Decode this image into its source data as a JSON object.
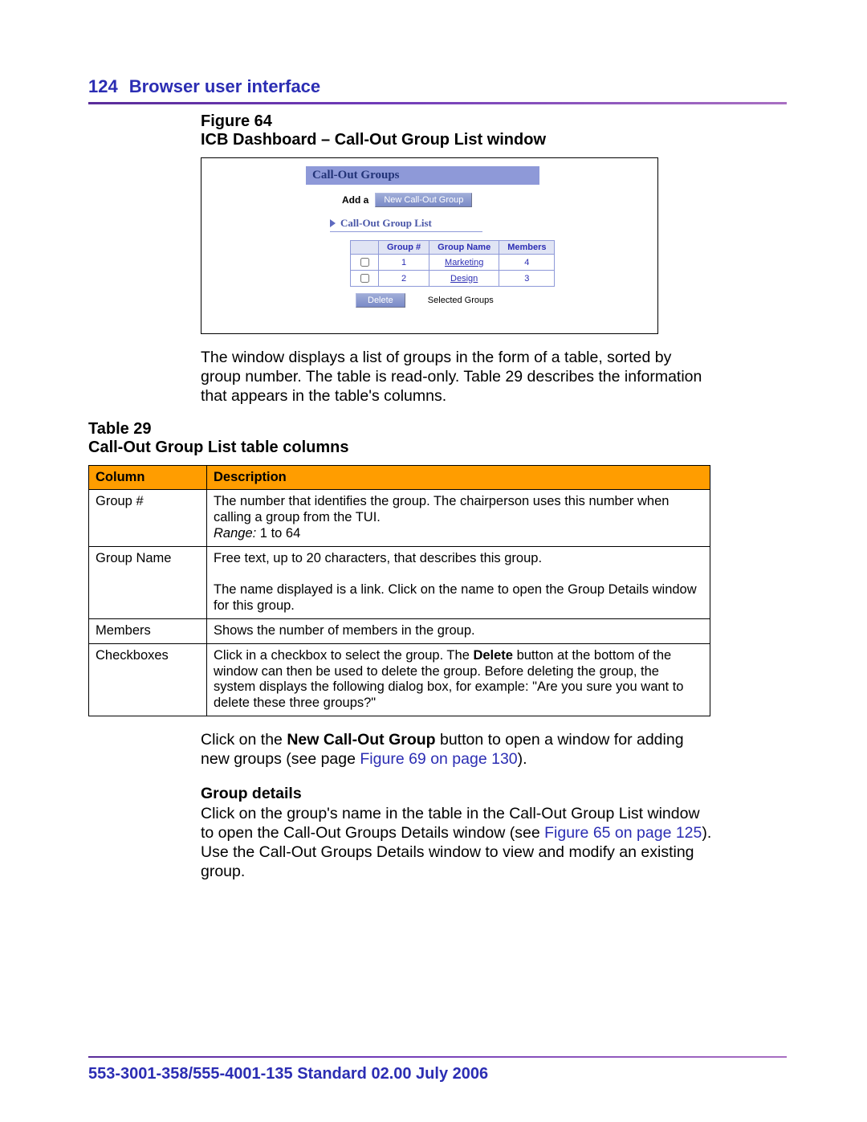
{
  "header": {
    "page_number": "124",
    "chapter": "Browser user interface"
  },
  "figure": {
    "label": "Figure 64",
    "title": "ICB Dashboard – Call-Out Group List window",
    "panel_title": "Call-Out Groups",
    "add_label": "Add a",
    "new_button": "New Call-Out Group",
    "list_title": "Call-Out Group List",
    "columns": [
      "Group #",
      "Group Name",
      "Members"
    ],
    "rows": [
      {
        "num": "1",
        "name": "Marketing",
        "members": "4"
      },
      {
        "num": "2",
        "name": "Design",
        "members": "3"
      }
    ],
    "delete_button": "Delete",
    "selected_label": "Selected Groups"
  },
  "para1": "The window displays a list of groups in the form of a table, sorted by group number. The table is read-only. Table 29 describes the information that appears in the table's columns.",
  "table": {
    "label": "Table 29",
    "title": "Call-Out Group List table columns",
    "head_col": "Column",
    "head_desc": "Description",
    "rows": [
      {
        "col": "Group #",
        "desc": "The number that identifies the group. The chairperson uses this number when calling a group from the TUI.",
        "range_label": "Range:",
        "range_val": " 1 to 64"
      },
      {
        "col": "Group Name",
        "desc_a": "Free text, up to 20 characters, that describes this group.",
        "desc_b": "The name displayed is a link. Click on the name to open the Group Details window for this group."
      },
      {
        "col": "Members",
        "desc": "Shows the number of members in the group."
      },
      {
        "col": "Checkboxes",
        "desc_pre": "Click in a checkbox to select the group. The ",
        "desc_bold": "Delete",
        "desc_post": " button at the bottom of the window can then be used to delete the group. Before deleting the group, the system displays the following dialog box, for example: \"Are you sure you want to delete these three groups?\""
      }
    ]
  },
  "para2": {
    "pre": "Click on the ",
    "bold": "New Call-Out Group",
    "mid": " button to open a window for adding new groups (see page ",
    "xref": "Figure 69 on page 130",
    "post": ")."
  },
  "sub_heading": "Group details",
  "para3": {
    "pre": "Click on the group's name in the table in the Call-Out Group List window to open the Call-Out Groups Details window (see ",
    "xref": "Figure 65 on page 125",
    "post": "). Use the Call-Out Groups Details window to view and modify an existing group."
  },
  "footer": "553-3001-358/555-4001-135   Standard   02.00   July 2006"
}
